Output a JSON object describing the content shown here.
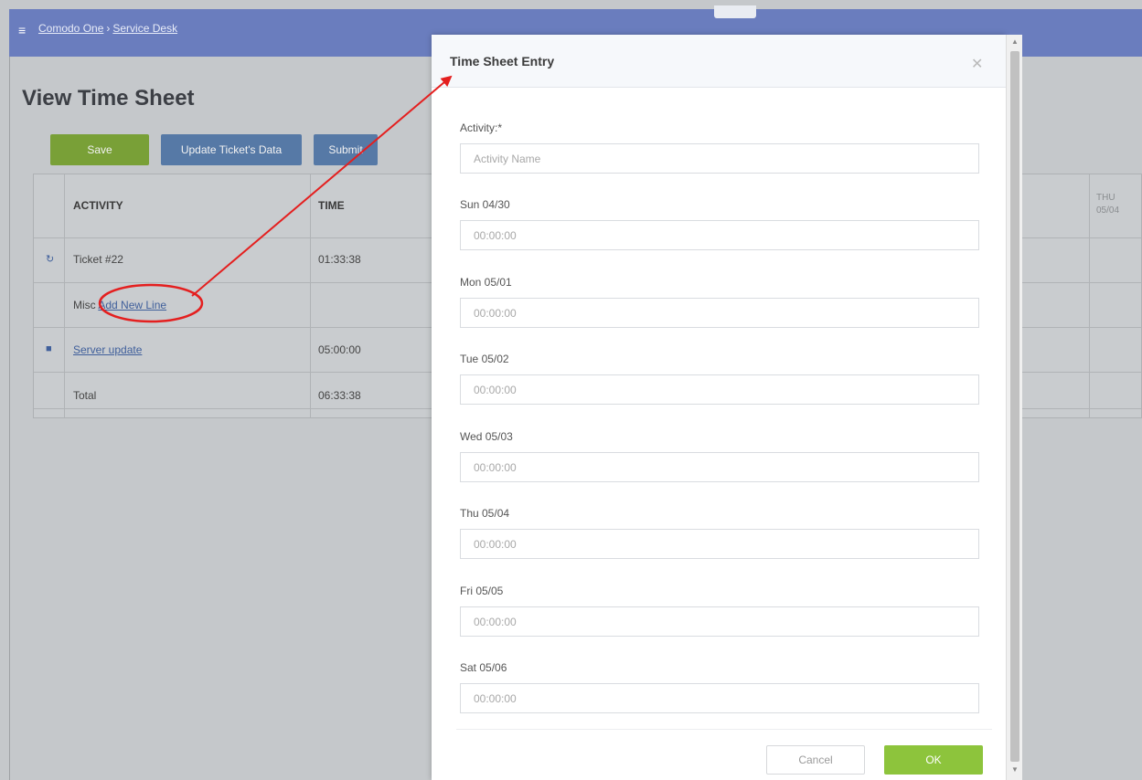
{
  "nav": {
    "menu_icon": "hamburger-icon",
    "breadcrumb": [
      "Comodo One",
      "Service Desk"
    ],
    "separator": "›"
  },
  "page": {
    "title": "View Time Sheet",
    "buttons": {
      "save": "Save",
      "update": "Update Ticket's Data",
      "submit": "Submit"
    },
    "table": {
      "headers": [
        "ACTIVITY",
        "TIME"
      ],
      "extra_header": [
        "THU",
        "05/04"
      ],
      "rows": [
        {
          "icon": "refresh-icon",
          "activity": "Ticket #22",
          "time": "01:33:38"
        },
        {
          "misc": "Misc",
          "link": "Add New Line"
        },
        {
          "icon": "trash-icon",
          "activity": "Server update",
          "time": "05:00:00"
        },
        {
          "activity": "Total",
          "time": "06:33:38"
        }
      ]
    }
  },
  "modal": {
    "title": "Time Sheet Entry",
    "close_icon": "close-icon",
    "activity_label": "Activity:*",
    "activity_placeholder": "Activity Name",
    "days": [
      {
        "label": "Sun 04/30",
        "value": "00:00:00"
      },
      {
        "label": "Mon 05/01",
        "value": "00:00:00"
      },
      {
        "label": "Tue 05/02",
        "value": "00:00:00"
      },
      {
        "label": "Wed 05/03",
        "value": "00:00:00"
      },
      {
        "label": "Thu 05/04",
        "value": "00:00:00"
      },
      {
        "label": "Fri 05/05",
        "value": "00:00:00"
      },
      {
        "label": "Sat 05/06",
        "value": "00:00:00"
      }
    ],
    "cancel": "Cancel",
    "ok": "OK"
  },
  "colors": {
    "annotation": "#e41f1f",
    "header_bar": "#6a7dbe",
    "ok_button": "#8dc43c",
    "save_button": "#79a037",
    "blue_button": "#5679a6"
  }
}
